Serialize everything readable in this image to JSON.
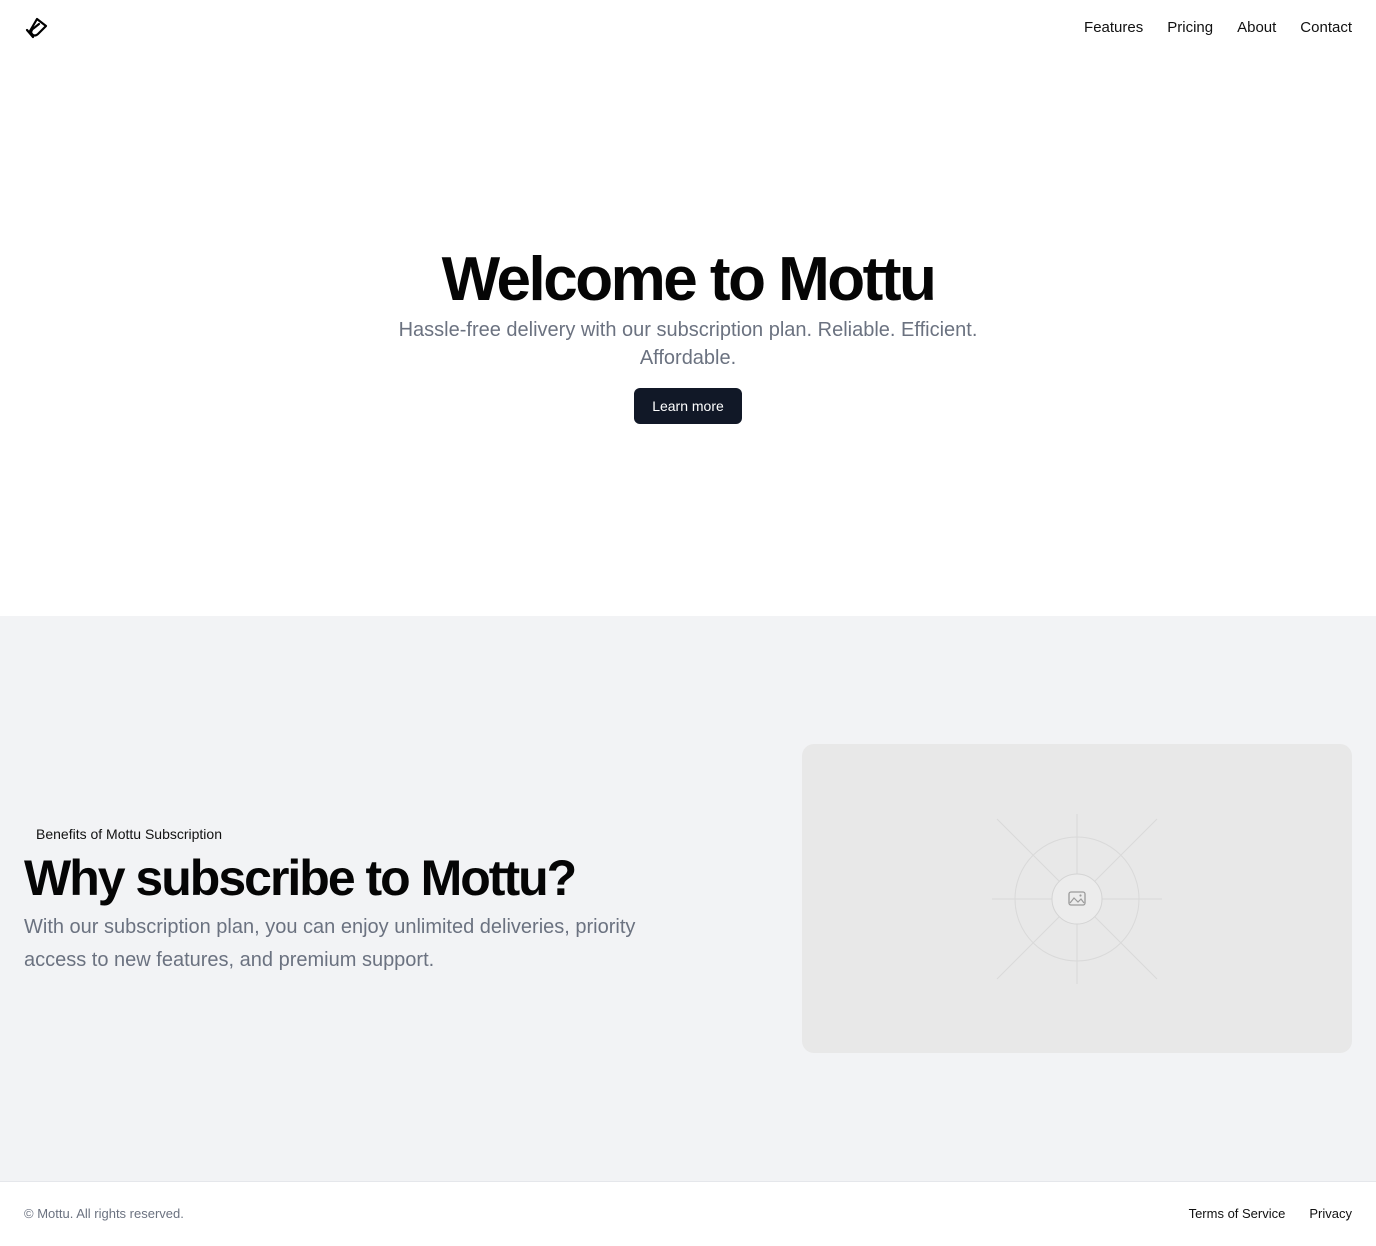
{
  "header": {
    "logo_icon": "magnet-logo-icon",
    "nav": [
      {
        "label": "Features"
      },
      {
        "label": "Pricing"
      },
      {
        "label": "About"
      },
      {
        "label": "Contact"
      }
    ]
  },
  "hero": {
    "title": "Welcome to Mottu",
    "subtitle": "Hassle-free delivery with our subscription plan. Reliable. Efficient. Affordable.",
    "button_label": "Learn more"
  },
  "features": {
    "eyebrow": "Benefits of Mottu Subscription",
    "title": "Why subscribe to Mottu?",
    "description": "With our subscription plan, you can enjoy unlimited deliveries, priority access to new features, and premium support.",
    "image_icon": "image-placeholder-icon"
  },
  "footer": {
    "copyright": "© Mottu. All rights reserved.",
    "links": [
      {
        "label": "Terms of Service"
      },
      {
        "label": "Privacy"
      }
    ]
  },
  "colors": {
    "primary_button": "#111827",
    "section_background": "#f2f3f5",
    "muted_text": "#6b7280"
  }
}
